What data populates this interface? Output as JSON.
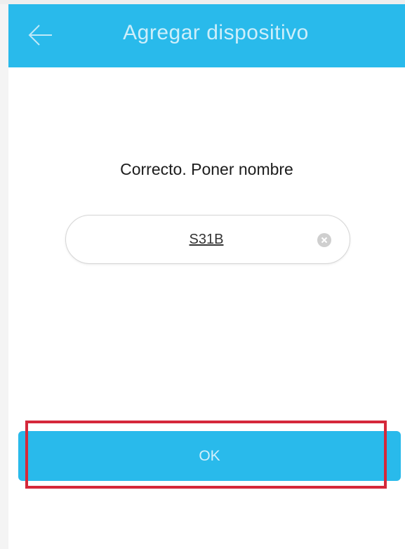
{
  "header": {
    "title": "Agregar dispositivo",
    "back_icon": "arrow-left-icon"
  },
  "main": {
    "prompt": "Correcto. Poner nombre",
    "name_field": {
      "value": "S31B",
      "clear_icon": "clear-circle-icon"
    },
    "ok_label": "OK"
  },
  "colors": {
    "accent": "#29baeb",
    "highlight": "#d5283a"
  }
}
